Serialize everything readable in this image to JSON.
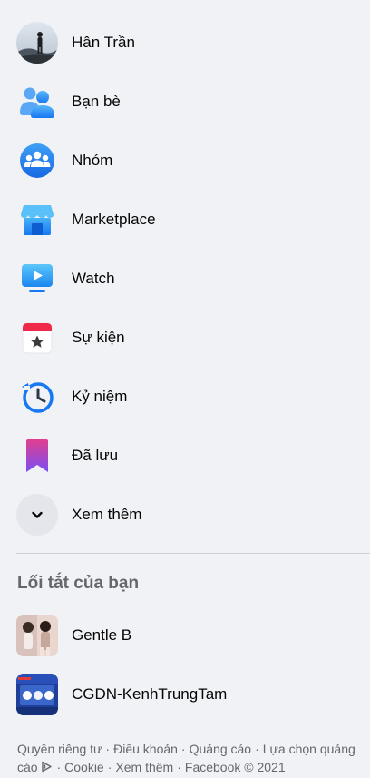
{
  "nav": {
    "profile": {
      "label": "Hân Trần",
      "icon": "profile-avatar"
    },
    "items": [
      {
        "label": "Bạn bè",
        "icon": "friends-icon",
        "color": "#1877f2"
      },
      {
        "label": "Nhóm",
        "icon": "groups-icon",
        "color": "#1877f2"
      },
      {
        "label": "Marketplace",
        "icon": "marketplace-icon",
        "color": "#1877f2"
      },
      {
        "label": "Watch",
        "icon": "watch-icon",
        "color": "#1877f2"
      },
      {
        "label": "Sự kiện",
        "icon": "events-icon",
        "color": "#f02849"
      },
      {
        "label": "Kỷ niệm",
        "icon": "memories-icon",
        "color": "#1877f2"
      },
      {
        "label": "Đã lưu",
        "icon": "saved-icon",
        "color": "#9360f7"
      }
    ],
    "see_more": {
      "label": "Xem thêm",
      "icon": "chevron-down-icon"
    }
  },
  "shortcuts": {
    "title": "Lối tắt của bạn",
    "items": [
      {
        "label": "Gentle B",
        "icon": "group-thumbnail"
      },
      {
        "label": "CGDN-KenhTrungTam",
        "prefix_glyph": "",
        "icon": "group-thumbnail"
      }
    ]
  },
  "footer": {
    "links": [
      "Quyền riêng tư",
      "Điều khoản",
      "Quảng cáo",
      "Lựa chọn quảng cáo",
      "Cookie",
      "Xem thêm"
    ],
    "ad_choices_icon": "ad-choices-icon",
    "copyright": "Facebook © 2021",
    "separator": "·"
  }
}
